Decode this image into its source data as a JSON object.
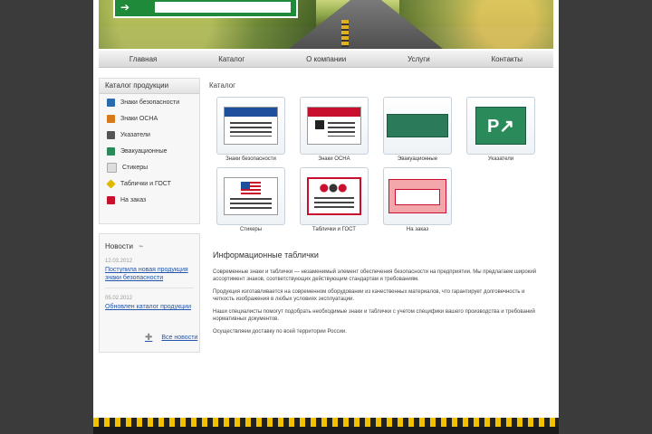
{
  "header": {
    "sign_text": "",
    "colors": {
      "sign_green": "#1e8a3a"
    }
  },
  "nav": {
    "items": [
      {
        "label": "Главная"
      },
      {
        "label": "Каталог"
      },
      {
        "label": "О компании"
      },
      {
        "label": "Услуги"
      },
      {
        "label": "Контакты"
      }
    ]
  },
  "sidebar": {
    "catalog_title": "Каталог продукции",
    "categories": [
      {
        "label": "Знаки безопасности",
        "icon": "blue-square-icon",
        "color": "#2a6bb0"
      },
      {
        "label": "Знаки ОСНА",
        "icon": "orange-square-icon",
        "color": "#d87a1a"
      },
      {
        "label": "Указатели",
        "icon": "pictogram-icon",
        "color": "#555555"
      },
      {
        "label": "Эвакуационные",
        "icon": "green-square-icon",
        "color": "#2b8a5a"
      },
      {
        "label": "Стикеры",
        "icon": "white-square-icon",
        "color": "#dddddd"
      },
      {
        "label": "Таблички и ГОСТ",
        "icon": "yellow-diamond-icon",
        "color": "#e0b800"
      },
      {
        "label": "На заказ",
        "icon": "red-square-icon",
        "color": "#c8102e"
      }
    ],
    "news_title": "Новости",
    "news": [
      {
        "date": "12.03.2012",
        "text": "Поступила новая продукция знаки безопасности"
      },
      {
        "date": "05.02.2012",
        "text": "Обновлен каталог продукции"
      }
    ],
    "archive_label": "Все новости"
  },
  "main": {
    "title": "Каталог",
    "products": [
      {
        "label": "Знаки безопасности",
        "type": "notice"
      },
      {
        "label": "Знаки ОСНА",
        "type": "danger"
      },
      {
        "label": "Эвакуационные",
        "type": "green-plate"
      },
      {
        "label": "Указатели",
        "type": "parking"
      },
      {
        "label": "Стикеры",
        "type": "flag"
      },
      {
        "label": "Таблички и ГОСТ",
        "type": "circles"
      },
      {
        "label": "На заказ",
        "type": "pink"
      }
    ],
    "article_title": "Информационные таблички",
    "paragraphs": [
      "Современные знаки и таблички — незаменимый элемент обеспечения безопасности на предприятии. Мы предлагаем широкий ассортимент знаков, соответствующих действующим стандартам и требованиям.",
      "Продукция изготавливается на современном оборудовании из качественных материалов, что гарантирует долговечность и четкость изображения в любых условиях эксплуатации.",
      "Наши специалисты помогут подобрать необходимые знаки и таблички с учетом специфики вашего производства и требований нормативных документов.",
      "Осуществляем доставку по всей территории России."
    ]
  }
}
